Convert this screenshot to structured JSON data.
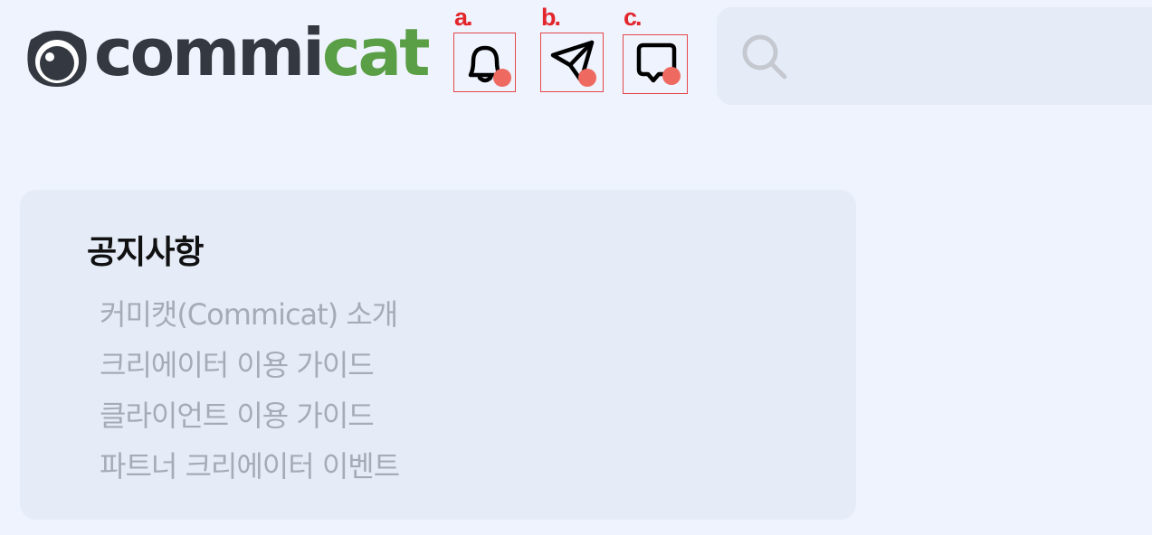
{
  "header": {
    "logo": {
      "text_dark": "commi",
      "text_green": "cat"
    },
    "icon_buttons": [
      {
        "marker": "a.",
        "icon": "bell-icon"
      },
      {
        "marker": "b.",
        "icon": "paper-plane-icon"
      },
      {
        "marker": "c.",
        "icon": "chat-bubble-icon"
      }
    ],
    "search": {
      "placeholder": "",
      "icon": "search-icon"
    }
  },
  "colors": {
    "background": "#eef3fd",
    "panel": "#e5ecf8",
    "brand_green": "#5a9e46",
    "brand_dark": "#343840",
    "annotation_red": "#e3262b",
    "badge": "#ee6a60"
  },
  "notice": {
    "title": "공지사항",
    "items": [
      "커미캣(Commicat) 소개",
      "크리에이터 이용 가이드",
      "클라이언트 이용 가이드",
      "파트너 크리에이터 이벤트"
    ]
  }
}
